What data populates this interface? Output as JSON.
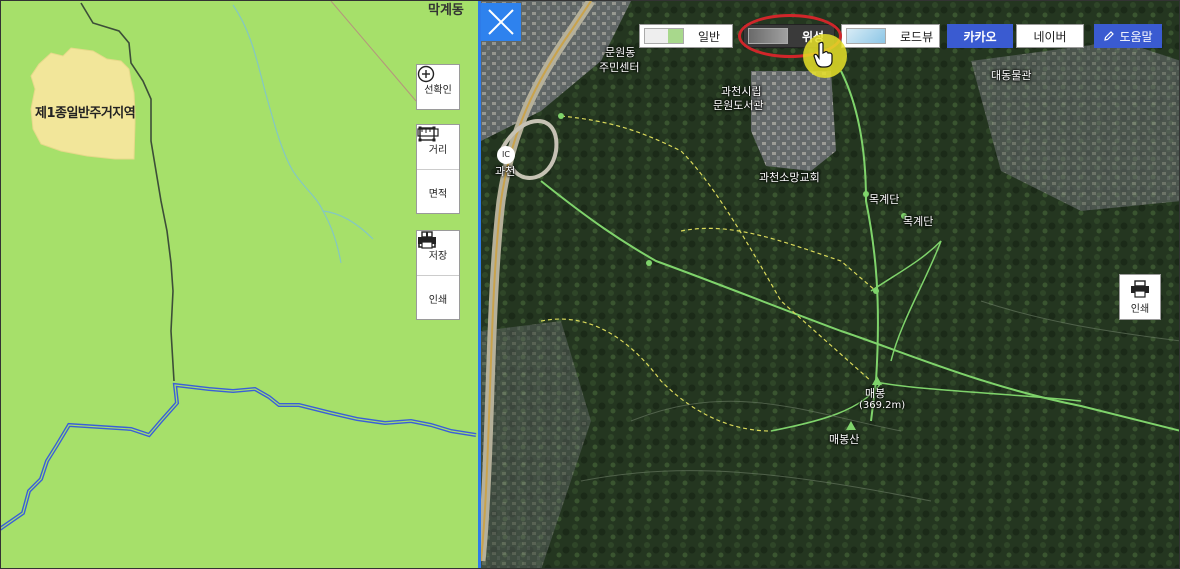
{
  "left_map": {
    "zone_label": "제1종일반주거지역",
    "place_top": "막계동",
    "tools": {
      "select": "선확인",
      "distance": "거리",
      "area": "면적",
      "save": "저장",
      "print": "인쇄"
    }
  },
  "right_map": {
    "map_types": [
      {
        "label": "일반",
        "active": false
      },
      {
        "label": "위성",
        "active": true
      },
      {
        "label": "로드뷰",
        "active": false
      }
    ],
    "providers": {
      "kakao": "카카오",
      "naver": "네이버",
      "help": "도움말"
    },
    "print_label": "인쇄",
    "labels": {
      "munwon_line1": "문원동",
      "munwon_line2": "주민센터",
      "library_line1": "과천시립",
      "library_line2": "문원도서관",
      "ic_badge": "IC",
      "gwacheon": "과천",
      "church": "과천소망교회",
      "mokgyedan1": "목계단",
      "mokgyedan2": "목계단",
      "maebong": "매봉",
      "maebong_height": "(369.2m)",
      "maebongsan": "매봉산",
      "daedong": "대동물관"
    }
  },
  "colors": {
    "zone_green": "#a6e06a",
    "residential_yellow": "#f2e69a",
    "boundary_blue": "#3a5fd8",
    "divider_blue": "#2e7be8",
    "trail_green": "#7fd36b",
    "accent_red": "#d0262a"
  },
  "icons": [
    "plus-circle-icon",
    "ruler-icon",
    "square-area-icon",
    "download-icon",
    "printer-icon",
    "close-icon",
    "pencil-icon",
    "hand-cursor-icon"
  ]
}
